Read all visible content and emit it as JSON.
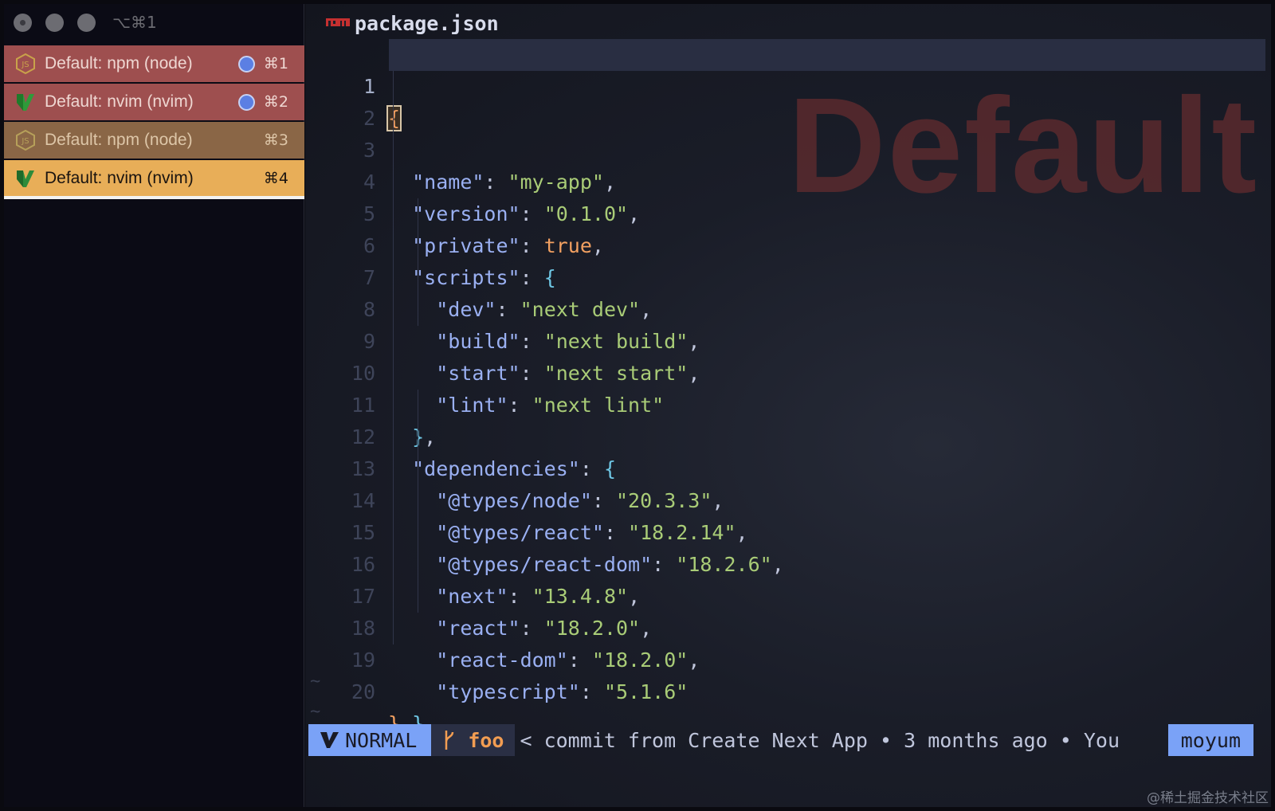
{
  "window": {
    "titlebar_label": "⌥⌘1"
  },
  "sidebar": {
    "tabs": [
      {
        "label": "Default: npm (node)",
        "shortcut": "⌘1",
        "icon": "nodejs-icon",
        "has_dot": true
      },
      {
        "label": "Default: nvim (nvim)",
        "shortcut": "⌘2",
        "icon": "vim-icon",
        "has_dot": true
      },
      {
        "label": "Default: npm (node)",
        "shortcut": "⌘3",
        "icon": "nodejs-icon",
        "has_dot": false
      },
      {
        "label": "Default: nvim (nvim)",
        "shortcut": "⌘4",
        "icon": "vim-icon",
        "has_dot": false,
        "active": true
      }
    ]
  },
  "editor": {
    "filename": "package.json",
    "watermark": "Default",
    "current_line": 1,
    "line_numbers": [
      "1",
      "2",
      "3",
      "4",
      "5",
      "6",
      "7",
      "8",
      "9",
      "10",
      "11",
      "12",
      "13",
      "14",
      "15",
      "16",
      "17",
      "18",
      "19",
      "20"
    ],
    "lines": [
      "{",
      "  \"name\": \"my-app\",",
      "  \"version\": \"0.1.0\",",
      "  \"private\": true,",
      "  \"scripts\": {",
      "    \"dev\": \"next dev\",",
      "    \"build\": \"next build\",",
      "    \"start\": \"next start\",",
      "    \"lint\": \"next lint\"",
      "  },",
      "  \"dependencies\": {",
      "    \"@types/node\": \"20.3.3\",",
      "    \"@types/react\": \"18.2.14\",",
      "    \"@types/react-dom\": \"18.2.6\",",
      "    \"next\": \"13.4.8\",",
      "    \"react\": \"18.2.0\",",
      "    \"react-dom\": \"18.2.0\",",
      "    \"typescript\": \"5.1.6\"",
      "  }",
      "}"
    ],
    "tildes": [
      "~",
      "~"
    ]
  },
  "statusline": {
    "mode": "NORMAL",
    "branch": "foo",
    "blame": "< commit from Create Next App • 3 months ago • You",
    "user": "moyum"
  },
  "corner_mark": "@稀土掘金技术社区",
  "colors": {
    "tab_red": "#9e4f4f",
    "tab_brown": "#8a6646",
    "tab_active": "#e8ae58",
    "mode_blue": "#7aa2f7",
    "string_green": "#a9cc77",
    "key_blue": "#9ab0f2",
    "bracket_orange": "#f2a061",
    "bracket_cyan": "#6ec6e4"
  }
}
